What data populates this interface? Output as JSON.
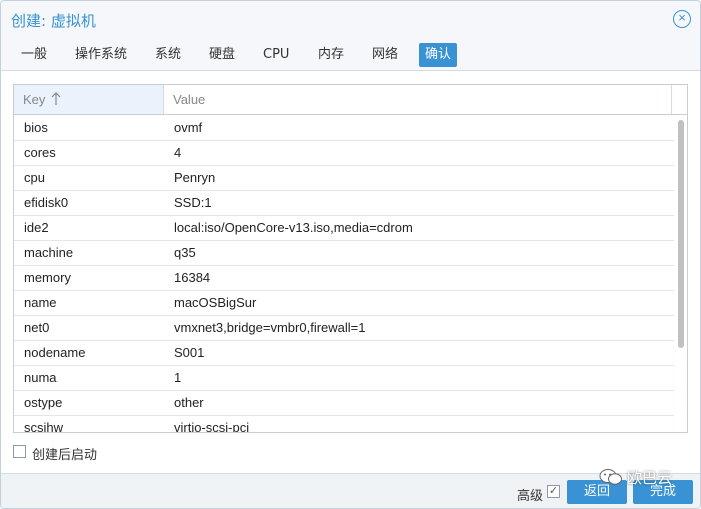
{
  "window": {
    "title": "创建: 虚拟机",
    "close_icon": "close-icon"
  },
  "tabs": [
    {
      "label": "一般",
      "active": false
    },
    {
      "label": "操作系统",
      "active": false
    },
    {
      "label": "系统",
      "active": false
    },
    {
      "label": "硬盘",
      "active": false
    },
    {
      "label": "CPU",
      "active": false
    },
    {
      "label": "内存",
      "active": false
    },
    {
      "label": "网络",
      "active": false
    },
    {
      "label": "确认",
      "active": true
    }
  ],
  "grid": {
    "columns": {
      "key": "Key",
      "sort_icon": "sort-ascending-icon",
      "value": "Value"
    },
    "rows": [
      {
        "key": "bios",
        "value": "ovmf"
      },
      {
        "key": "cores",
        "value": "4"
      },
      {
        "key": "cpu",
        "value": "Penryn"
      },
      {
        "key": "efidisk0",
        "value": "SSD:1"
      },
      {
        "key": "ide2",
        "value": "local:iso/OpenCore-v13.iso,media=cdrom"
      },
      {
        "key": "machine",
        "value": "q35"
      },
      {
        "key": "memory",
        "value": "16384"
      },
      {
        "key": "name",
        "value": "macOSBigSur"
      },
      {
        "key": "net0",
        "value": "vmxnet3,bridge=vmbr0,firewall=1"
      },
      {
        "key": "nodename",
        "value": "S001"
      },
      {
        "key": "numa",
        "value": "1"
      },
      {
        "key": "ostype",
        "value": "other"
      },
      {
        "key": "scsihw",
        "value": "virtio-scsi-pci"
      }
    ]
  },
  "autostart": {
    "label": "创建后启动",
    "checked": false
  },
  "footer": {
    "advanced_label": "高级",
    "advanced_checked": true,
    "back_label": "返回",
    "finish_label": "完成"
  },
  "watermark": {
    "text": "欧巴云",
    "icon": "wechat-icon"
  },
  "colors": {
    "accent": "#3892d4",
    "tab_bg": "#f5f7fa",
    "header_key_bg": "#eaf3fb"
  }
}
